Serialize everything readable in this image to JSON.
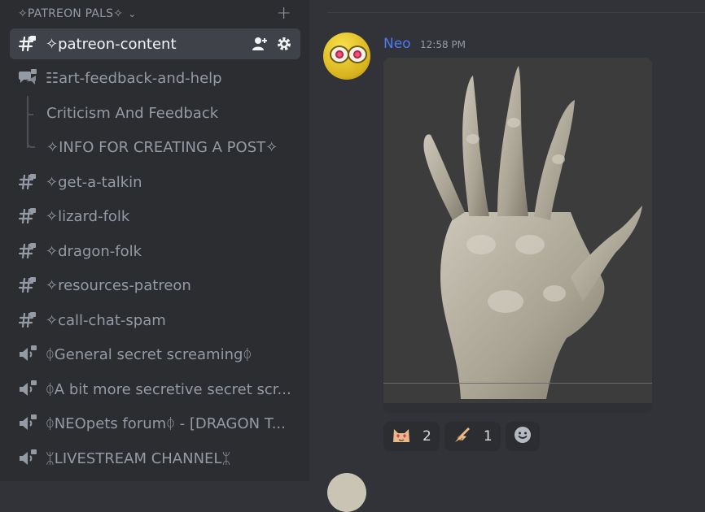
{
  "sidebar": {
    "category": {
      "label": "✧PATREON PALS✧",
      "chevron": "⌄",
      "add": "+"
    },
    "channels": [
      {
        "name": "✧patreon-content",
        "icon": "text-channel-locked-icon",
        "active": true
      },
      {
        "name": "☷art-feedback-and-help",
        "icon": "forum-channel-locked-icon"
      },
      {
        "name": "✧get-a-talkin",
        "icon": "text-channel-locked-icon"
      },
      {
        "name": "✧lizard-folk",
        "icon": "text-channel-locked-icon"
      },
      {
        "name": "✧dragon-folk",
        "icon": "text-channel-locked-icon"
      },
      {
        "name": "✧resources-patreon",
        "icon": "text-channel-locked-icon"
      },
      {
        "name": "✧call-chat-spam",
        "icon": "text-channel-locked-icon"
      },
      {
        "name": "ᛰGeneral secret screamingᛰ",
        "icon": "voice-channel-locked-icon"
      },
      {
        "name": "ᛰA bit more secretive secret scr...",
        "icon": "voice-channel-locked-icon"
      },
      {
        "name": "ᛰNEOpets forumᛰ - [DRAGON T...",
        "icon": "voice-channel-locked-icon"
      },
      {
        "name": "ᛯLIVESTREAM CHANNELᛯ",
        "icon": "voice-channel-locked-icon"
      }
    ],
    "threads": [
      {
        "name": "Criticism And Feedback"
      },
      {
        "name": "✧INFO FOR CREATING A POST✧"
      }
    ]
  },
  "message": {
    "author": "Neo",
    "author_color": "#4a7cf5",
    "timestamp": "12:58 PM",
    "attachment": "image of a sculpted clawed reptile hand",
    "reactions": [
      {
        "emoji": "cat-heart-eyes-emoji",
        "count": "2"
      },
      {
        "emoji": "pointing-hand-emoji",
        "count": "1"
      }
    ]
  }
}
